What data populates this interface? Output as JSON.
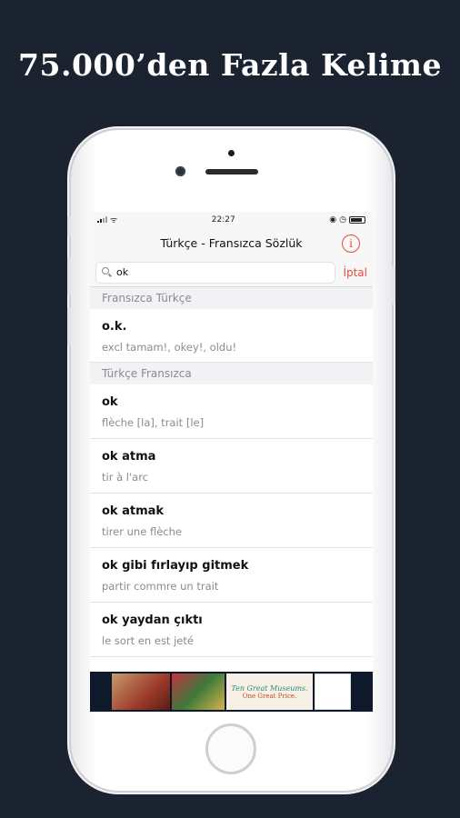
{
  "promo": {
    "headline": "75.000’den Fazla Kelime"
  },
  "statusbar": {
    "time": "22:27"
  },
  "navbar": {
    "title": "Türkçe - Fransızca Sözlük",
    "info_icon": "info-circle-icon",
    "accent": "#e64b3c"
  },
  "search": {
    "value": "ok",
    "cancel_label": "İptal"
  },
  "sections": [
    {
      "header": "Fransızca Türkçe",
      "entries": [
        {
          "word": "o.k.",
          "meaning": "excl tamam!, okey!, oldu!"
        }
      ]
    },
    {
      "header": "Türkçe Fransızca",
      "entries": [
        {
          "word": "ok",
          "meaning": "flèche [la], trait [le]"
        },
        {
          "word": "ok atma",
          "meaning": "tir à l'arc"
        },
        {
          "word": "ok atmak",
          "meaning": "tirer une flèche"
        },
        {
          "word": "ok gibi fırlayıp gitmek",
          "meaning": "partir commre un trait"
        },
        {
          "word": "ok yaydan çıktı",
          "meaning": "le sort en est jeté"
        }
      ]
    }
  ],
  "ad": {
    "line1": "Ten Great Museums.",
    "line2": "One Great Price."
  }
}
